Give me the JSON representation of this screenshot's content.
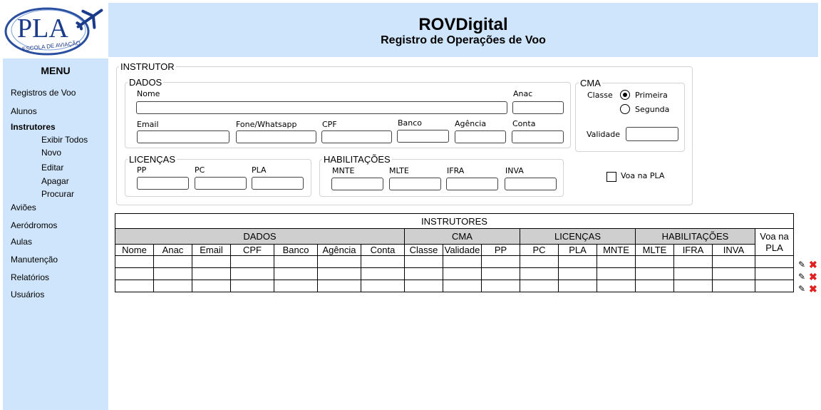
{
  "header": {
    "logo_text": "PLA",
    "logo_subtext": "ESCOLA DE AVIAÇÃO",
    "title": "ROVDigital",
    "subtitle": "Registro de Operações de Voo",
    "color": "#cfe5fb"
  },
  "sidebar": {
    "title": "MENU",
    "items": [
      {
        "label": "Registros de Voo"
      },
      {
        "label": "Alunos"
      },
      {
        "label": "Instrutores",
        "active": true
      },
      {
        "label": "Aviões"
      },
      {
        "label": "Aeródromos"
      },
      {
        "label": "Aulas"
      },
      {
        "label": "Manutenção"
      },
      {
        "label": "Relatórios"
      },
      {
        "label": "Usuários"
      }
    ],
    "subitems": [
      "Exibir Todos",
      "Novo",
      "Editar",
      "Apagar",
      "Procurar"
    ]
  },
  "form": {
    "title": "INSTRUTOR",
    "dados": {
      "title": "DADOS",
      "nome": "Nome",
      "anac": "Anac",
      "email": "Email",
      "fone": "Fone/Whatsapp",
      "cpf": "CPF",
      "banco": "Banco",
      "agencia": "Agência",
      "conta": "Conta",
      "values": {
        "nome": "",
        "anac": "",
        "email": "",
        "fone": "",
        "cpf": "",
        "banco": "",
        "agencia": "",
        "conta": ""
      }
    },
    "cma": {
      "title": "CMA",
      "classe": "Classe",
      "primeira": "Primeira",
      "segunda": "Segunda",
      "selected": "Primeira",
      "validade": "Validade",
      "validade_value": ""
    },
    "licencas": {
      "title": "LICENÇAS",
      "pp": "PP",
      "pc": "PC",
      "pla": "PLA"
    },
    "habilitacoes": {
      "title": "HABILITAÇÕES",
      "mnte": "MNTE",
      "mlte": "MLTE",
      "ifra": "IFRA",
      "inva": "INVA"
    },
    "voa_na_pla": {
      "label": "Voa na PLA",
      "checked": false
    }
  },
  "table": {
    "title": "INSTRUTORES",
    "groups": {
      "dados": "DADOS",
      "cma": "CMA",
      "licencas": "LICENÇAS",
      "habilitacoes": "HABILITAÇÕES"
    },
    "voa_header": "Voa na PLA",
    "columns": [
      "Nome",
      "Anac",
      "Email",
      "CPF",
      "Banco",
      "Agência",
      "Conta",
      "Classe",
      "Validade",
      "PP",
      "PC",
      "PLA",
      "MNTE",
      "MLTE",
      "IFRA",
      "INVA"
    ],
    "rows": [
      [
        "",
        "",
        "",
        "",
        "",
        "",
        "",
        "",
        "",
        "",
        "",
        "",
        "",
        "",
        "",
        "",
        ""
      ],
      [
        "",
        "",
        "",
        "",
        "",
        "",
        "",
        "",
        "",
        "",
        "",
        "",
        "",
        "",
        "",
        "",
        ""
      ],
      [
        "",
        "",
        "",
        "",
        "",
        "",
        "",
        "",
        "",
        "",
        "",
        "",
        "",
        "",
        "",
        "",
        ""
      ]
    ],
    "row_actions": [
      "pencil-icon",
      "delete-icon"
    ]
  }
}
